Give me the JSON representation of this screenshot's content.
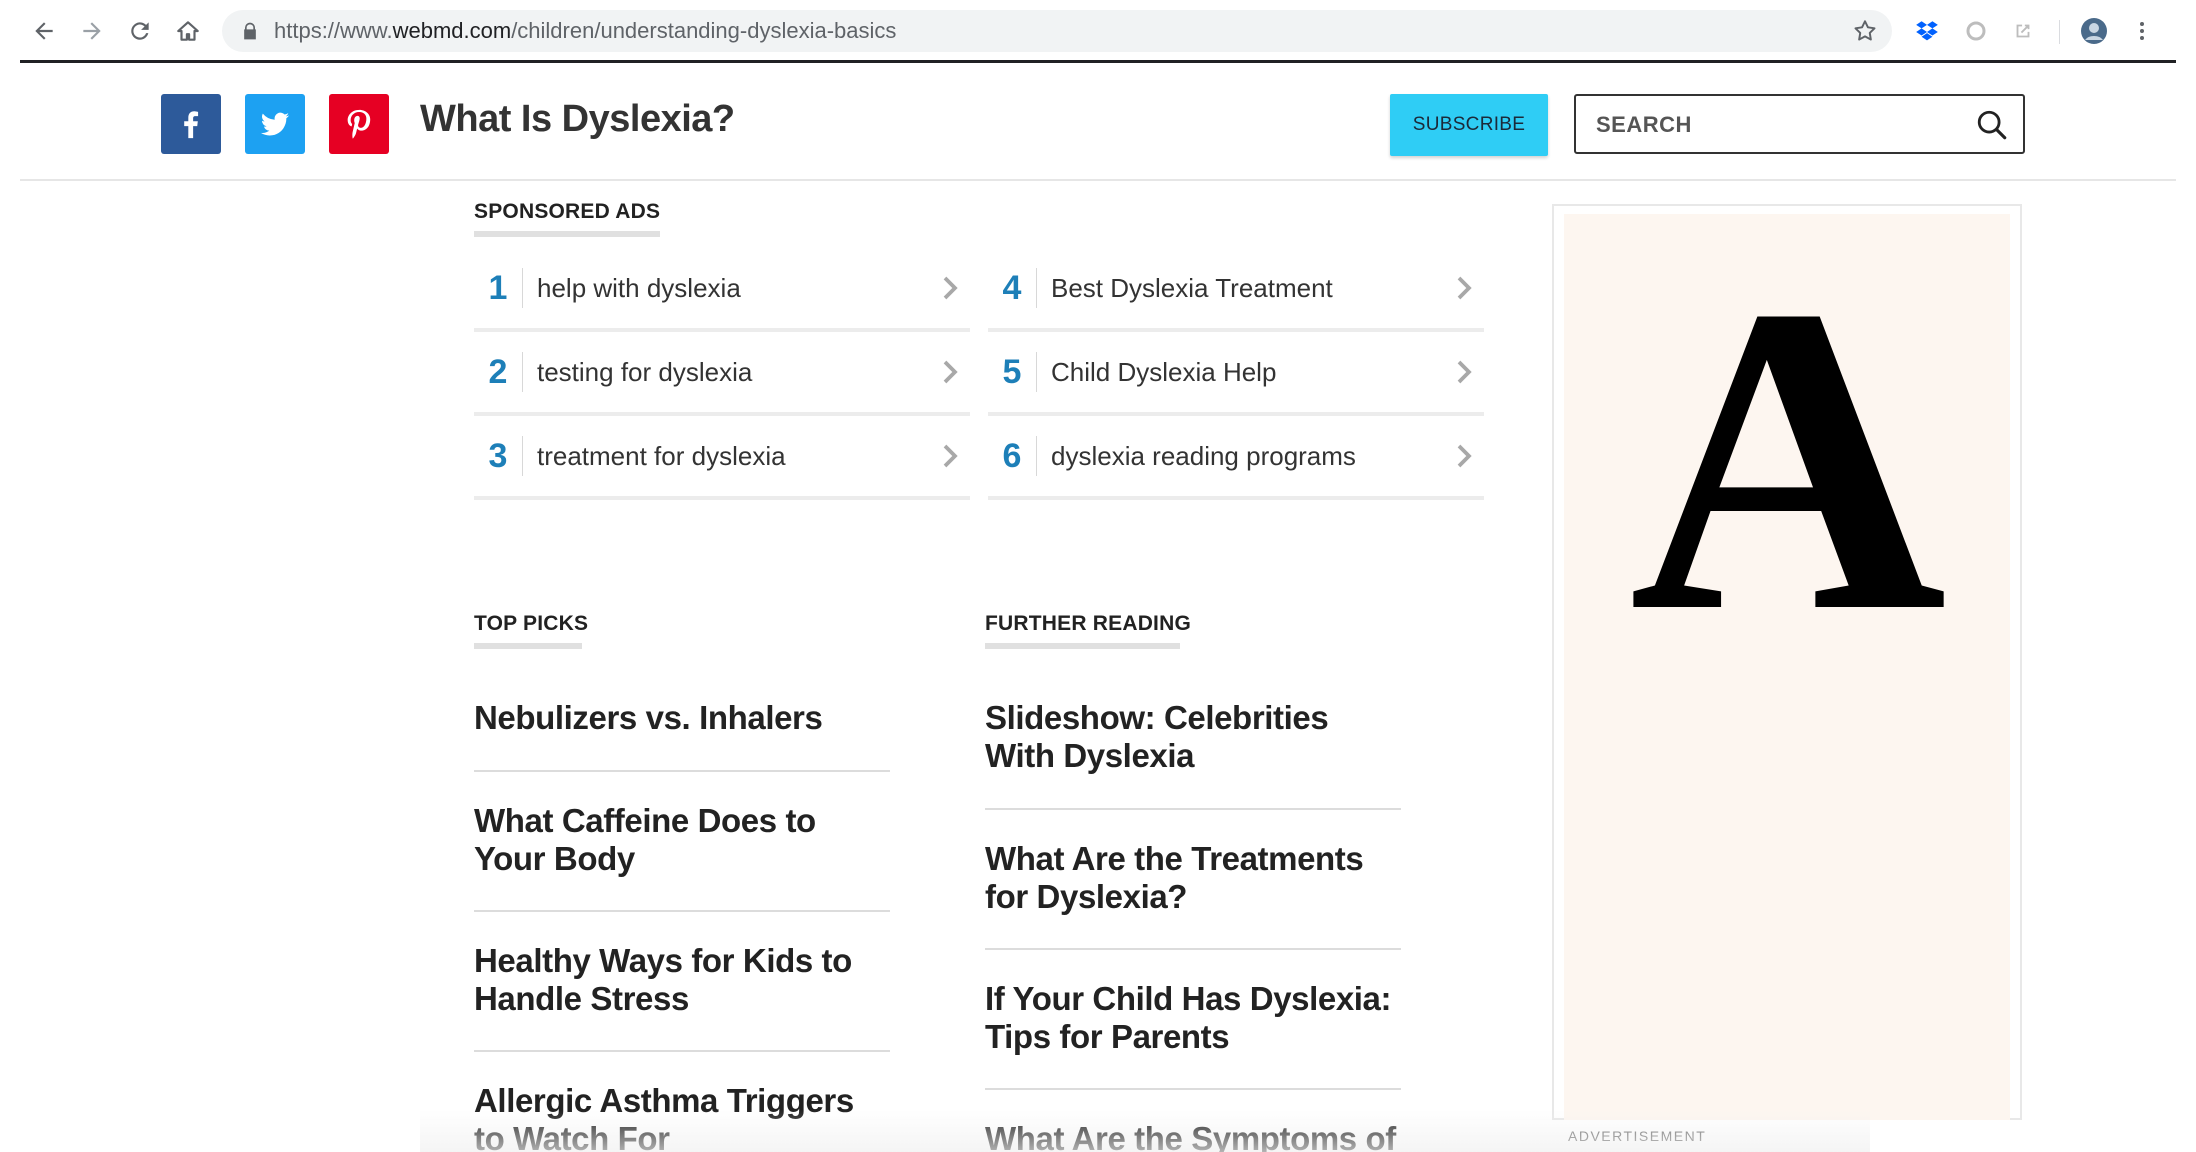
{
  "browser": {
    "url_prefix": "https://www.",
    "url_host": "webmd.com",
    "url_path": "/children/understanding-dyslexia-basics"
  },
  "header": {
    "title": "What Is Dyslexia?",
    "subscribe_label": "SUBSCRIBE",
    "search_placeholder": "SEARCH",
    "social": [
      "facebook-icon",
      "twitter-icon",
      "pinterest-icon"
    ],
    "colors": {
      "facebook": "#2d5a9a",
      "twitter": "#1da1f2",
      "pinterest": "#e60023",
      "subscribe": "#2fcdf5"
    }
  },
  "sponsored": {
    "heading": "SPONSORED ADS",
    "items": [
      {
        "num": "1",
        "label": "help with dyslexia"
      },
      {
        "num": "2",
        "label": "testing for dyslexia"
      },
      {
        "num": "3",
        "label": "treatment for dyslexia"
      },
      {
        "num": "4",
        "label": "Best Dyslexia Treatment"
      },
      {
        "num": "5",
        "label": "Child Dyslexia Help"
      },
      {
        "num": "6",
        "label": "dyslexia reading programs"
      }
    ]
  },
  "top_picks": {
    "heading": "TOP PICKS",
    "items": [
      "Nebulizers vs. Inhalers",
      "What Caffeine Does to Your Body",
      "Healthy Ways for Kids to Handle Stress",
      "Allergic Asthma Triggers to Watch For"
    ]
  },
  "further_reading": {
    "heading": "FURTHER READING",
    "items": [
      "Slideshow: Celebrities With Dyslexia",
      "What Are the Treatments for Dyslexia?",
      "If Your Child Has Dyslexia: Tips for Parents",
      "What Are the Symptoms of Dyslexia?"
    ]
  },
  "ad": {
    "letter": "A",
    "caption": "ADVERTISEMENT"
  }
}
